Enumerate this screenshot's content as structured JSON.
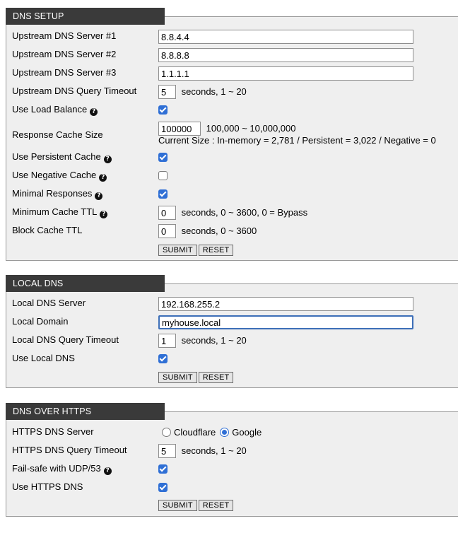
{
  "dns_setup": {
    "title": "DNS SETUP",
    "upstream1": {
      "label": "Upstream DNS Server #1",
      "value": "8.8.4.4"
    },
    "upstream2": {
      "label": "Upstream DNS Server #2",
      "value": "8.8.8.8"
    },
    "upstream3": {
      "label": "Upstream DNS Server #3",
      "value": "1.1.1.1"
    },
    "query_timeout": {
      "label": "Upstream DNS Query Timeout",
      "value": "5",
      "hint": "seconds, 1 ~ 20"
    },
    "load_balance": {
      "label": "Use Load Balance",
      "checked": true
    },
    "cache_size": {
      "label": "Response Cache Size",
      "value": "100000",
      "hint": "100,000 ~ 10,000,000",
      "current": "Current Size : In-memory = 2,781 / Persistent = 3,022 / Negative = 0"
    },
    "persistent_cache": {
      "label": "Use Persistent Cache",
      "checked": true
    },
    "negative_cache": {
      "label": "Use Negative Cache",
      "checked": false
    },
    "minimal_responses": {
      "label": "Minimal Responses",
      "checked": true
    },
    "min_cache_ttl": {
      "label": "Minimum Cache TTL",
      "value": "0",
      "hint": "seconds, 0 ~ 3600, 0 = Bypass"
    },
    "block_cache_ttl": {
      "label": "Block Cache TTL",
      "value": "0",
      "hint": "seconds, 0 ~ 3600"
    },
    "submit": "SUBMIT",
    "reset": "RESET"
  },
  "local_dns": {
    "title": "LOCAL DNS",
    "server": {
      "label": "Local DNS Server",
      "value": "192.168.255.2"
    },
    "domain": {
      "label": "Local Domain",
      "value": "myhouse.local"
    },
    "timeout": {
      "label": "Local DNS Query Timeout",
      "value": "1",
      "hint": "seconds, 1 ~ 20"
    },
    "use_local": {
      "label": "Use Local DNS",
      "checked": true
    },
    "submit": "SUBMIT",
    "reset": "RESET"
  },
  "doh": {
    "title": "DNS OVER HTTPS",
    "server": {
      "label": "HTTPS DNS Server",
      "options": [
        "Cloudflare",
        "Google"
      ],
      "selected": "Google"
    },
    "timeout": {
      "label": "HTTPS DNS Query Timeout",
      "value": "5",
      "hint": "seconds, 1 ~ 20"
    },
    "failsafe": {
      "label": "Fail-safe with UDP/53",
      "checked": true
    },
    "use_https": {
      "label": "Use HTTPS DNS",
      "checked": true
    },
    "submit": "SUBMIT",
    "reset": "RESET"
  }
}
